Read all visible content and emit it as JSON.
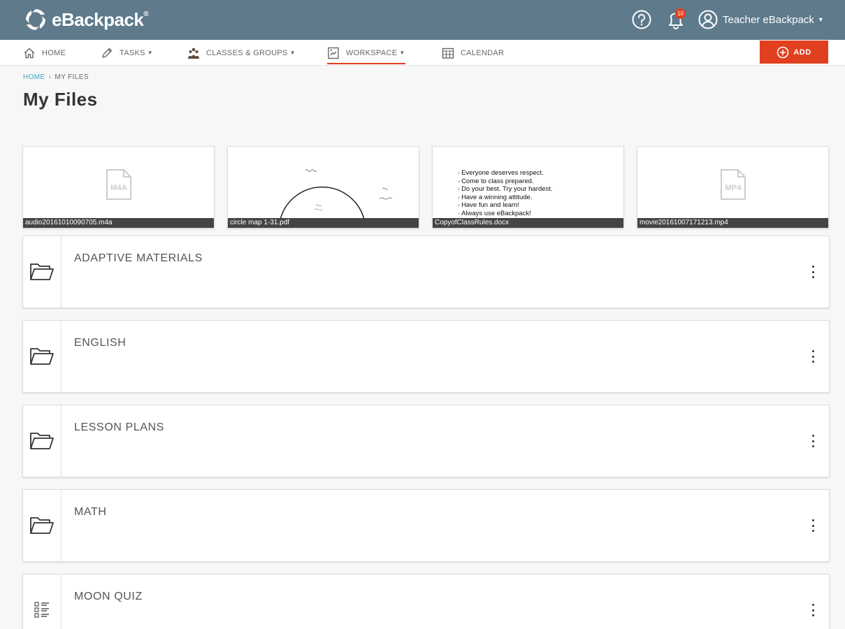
{
  "app": {
    "logo_text": "eBackpack",
    "logo_mark": "®"
  },
  "header": {
    "notifications_count": "10",
    "user_name": "Teacher eBackpack"
  },
  "nav": {
    "home": "HOME",
    "tasks": "TASKS",
    "classes": "CLASSES & GROUPS",
    "workspace": "WORKSPACE",
    "calendar": "CALENDAR",
    "add": "ADD"
  },
  "breadcrumb": {
    "home": "HOME",
    "separator": "›",
    "current": "MY FILES"
  },
  "page": {
    "title": "My Files"
  },
  "files": [
    {
      "name": "audio20161010090705.m4a",
      "ext": "M4A"
    },
    {
      "name": "circle map 1-31.pdf"
    },
    {
      "name": "CopyofClassRules.docx",
      "lines": [
        "Everyone deserves respect.",
        "Come to class prepared.",
        "Do your best.  Try your hardest.",
        "Have a winning attitude.",
        "Have fun and learn!",
        "Always use eBackpack!"
      ]
    },
    {
      "name": "movie20161007171213.mp4",
      "ext": "MP4"
    }
  ],
  "folders": [
    {
      "label": "ADAPTIVE MATERIALS",
      "icon": "folder-icon"
    },
    {
      "label": "ENGLISH",
      "icon": "folder-icon"
    },
    {
      "label": "LESSON PLANS",
      "icon": "folder-icon"
    },
    {
      "label": "MATH",
      "icon": "folder-icon"
    },
    {
      "label": "MOON QUIZ",
      "icon": "quiz-list-icon"
    }
  ],
  "colors": {
    "header_bg": "#5e7a8b",
    "accent": "#e1401f",
    "link": "#3aa6c4"
  }
}
